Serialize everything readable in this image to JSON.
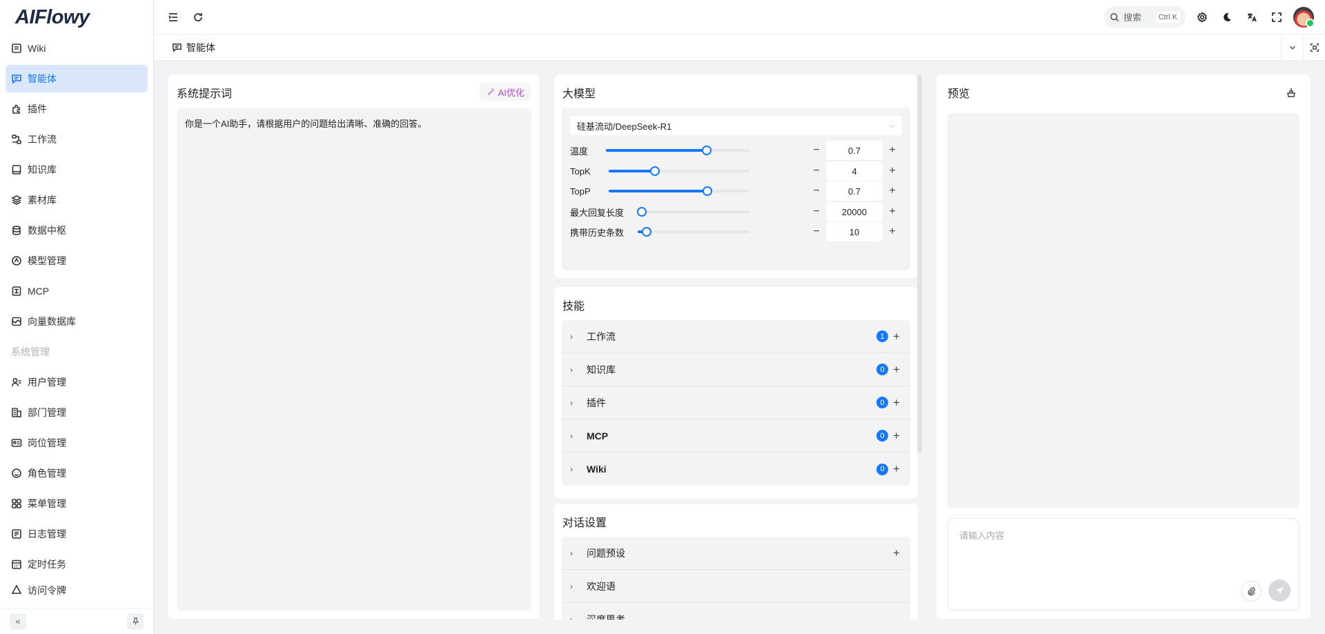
{
  "app": {
    "logo": "AIFlowy"
  },
  "sidebar": {
    "items": [
      {
        "label": "Wiki",
        "icon": "document-icon"
      },
      {
        "label": "智能体",
        "icon": "chat-icon",
        "active": true
      },
      {
        "label": "插件",
        "icon": "plugin-icon"
      },
      {
        "label": "工作流",
        "icon": "workflow-icon"
      },
      {
        "label": "知识库",
        "icon": "book-icon"
      },
      {
        "label": "素材库",
        "icon": "layers-icon"
      },
      {
        "label": "数据中枢",
        "icon": "database-icon"
      },
      {
        "label": "模型管理",
        "icon": "model-icon"
      },
      {
        "label": "MCP",
        "icon": "mcp-icon"
      },
      {
        "label": "向量数据库",
        "icon": "vector-db-icon"
      }
    ],
    "group_label": "系统管理",
    "system_items": [
      {
        "label": "用户管理",
        "icon": "user-icon"
      },
      {
        "label": "部门管理",
        "icon": "department-icon"
      },
      {
        "label": "岗位管理",
        "icon": "id-card-icon"
      },
      {
        "label": "角色管理",
        "icon": "smile-icon"
      },
      {
        "label": "菜单管理",
        "icon": "grid-icon"
      },
      {
        "label": "日志管理",
        "icon": "log-icon"
      },
      {
        "label": "定时任务",
        "icon": "calendar-icon"
      },
      {
        "label": "访问令牌",
        "icon": "token-icon"
      }
    ]
  },
  "header": {
    "search_label": "搜索",
    "search_shortcut": "Ctrl K"
  },
  "tabs": [
    {
      "label": "智能体"
    }
  ],
  "prompt": {
    "title": "系统提示词",
    "ai_optimize_label": "AI优化",
    "text": "你是一个AI助手，请根据用户的问题给出清晰、准确的回答。"
  },
  "model": {
    "title": "大模型",
    "selected": "硅基流动/DeepSeek-R1",
    "params": [
      {
        "label": "温度",
        "value": "0.7",
        "fraction": 0.7
      },
      {
        "label": "TopK",
        "value": "4",
        "fraction": 0.33
      },
      {
        "label": "TopP",
        "value": "0.7",
        "fraction": 0.7
      },
      {
        "label": "最大回复长度",
        "value": "20000",
        "fraction": 0.04
      },
      {
        "label": "携带历史条数",
        "value": "10",
        "fraction": 0.08
      }
    ],
    "minus": "−",
    "plus": "+"
  },
  "skills": {
    "title": "技能",
    "items": [
      {
        "label": "工作流",
        "count": "1"
      },
      {
        "label": "知识库",
        "count": "0"
      },
      {
        "label": "插件",
        "count": "0"
      },
      {
        "label": "MCP",
        "count": "0"
      },
      {
        "label": "Wiki",
        "count": "0"
      }
    ]
  },
  "dialog": {
    "title": "对话设置",
    "items": [
      {
        "label": "问题预设"
      },
      {
        "label": "欢迎语"
      },
      {
        "label": "深度思考"
      }
    ]
  },
  "preview": {
    "title": "预览",
    "input_placeholder": "请输入内容"
  },
  "colors": {
    "accent": "#1677ff",
    "active_bg": "#dbe8fb",
    "ai_optimize": "#c04cd8"
  }
}
